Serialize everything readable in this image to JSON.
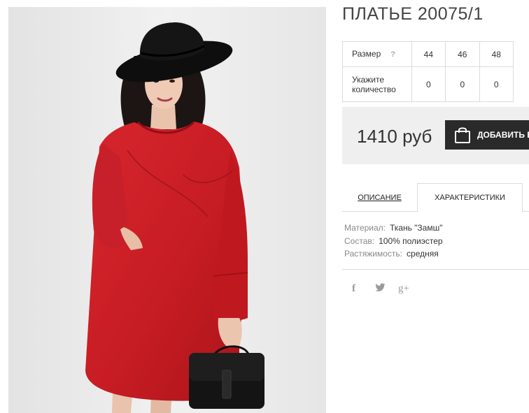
{
  "product": {
    "title": "ПЛАТЬЕ 20075/1",
    "image_alt": "model in red suede dress with black hat and black handbag"
  },
  "size_table": {
    "size_label": "Размер",
    "help_mark": "?",
    "sizes": [
      "44",
      "46",
      "48"
    ],
    "qty_label_line1": "Укажите",
    "qty_label_line2": "количество",
    "quantities": [
      "0",
      "0",
      "0"
    ]
  },
  "purchase": {
    "price": "1410 руб",
    "cart_button_label": "ДОБАВИТЬ В КОРЗИНУ",
    "cart_icon": "shopping-bag-icon",
    "button_color": "#2a2a2a"
  },
  "tabs": {
    "description": "ОПИСАНИЕ",
    "characteristics": "ХАРАКТЕРИСТИКИ",
    "active": "characteristics"
  },
  "specs": [
    {
      "key": "Материал:",
      "value": "Ткань \"Замш\""
    },
    {
      "key": "Состав:",
      "value": "100% полиэстер"
    },
    {
      "key": "Растяжимость:",
      "value": "средняя"
    }
  ],
  "social": {
    "facebook": "f",
    "twitter": "twitter-icon",
    "google": "g+"
  },
  "colors": {
    "dress": "#c41b22",
    "price_box": "#efefef",
    "border": "#dcdcdc"
  }
}
